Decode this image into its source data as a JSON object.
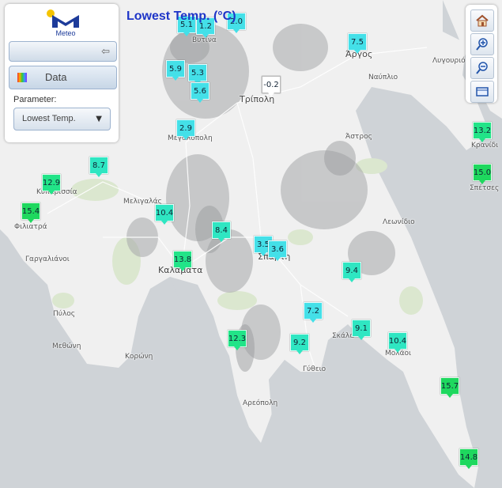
{
  "title": "Lowest Temp. (°C)",
  "panel": {
    "logo_text": "Meteo",
    "data_label": "Data",
    "parameter_label": "Parameter:",
    "parameter_value": "Lowest Temp."
  },
  "tools": [
    "home-icon",
    "zoom-in-icon",
    "zoom-out-icon",
    "extent-icon"
  ],
  "colors": {
    "cold": "#44e0e8",
    "cool": "#2fe6c2",
    "mild": "#22e488",
    "warm": "#1ed85e",
    "freezing": "#ffffff",
    "title": "#1e35c8"
  },
  "places": {
    "argos": "Άργος",
    "nafplio": "Ναύπλιο",
    "lygourio": "Λυγουριό",
    "tripoli": "Τρίπολη",
    "vytina": "Βυτίνα",
    "megalopoli": "Μεγαλόπολη",
    "astros": "Άστρος",
    "kranidi": "Κρανίδι",
    "spetses": "Σπέτσες",
    "kyparissia": "Κυπαρισσία",
    "filiatra": "Φιλιατρά",
    "meligalas": "Μελιγαλάς",
    "gargalianoi": "Γαργαλιάνοι",
    "kalamata": "Καλαμάτα",
    "leonidio": "Λεωνίδιο",
    "sparti": "Σπάρτη",
    "pylos": "Πύλος",
    "methoni": "Μεθώνη",
    "koroni": "Κορώνη",
    "skala": "Σκάλα",
    "molaoi": "Μολάοι",
    "gytheio": "Γύθειο",
    "areopoli": "Αρεόπολη"
  },
  "stations": [
    {
      "value": "5.1",
      "band": "cold"
    },
    {
      "value": "1.2",
      "band": "cold"
    },
    {
      "value": "2.0",
      "band": "cold"
    },
    {
      "value": "7.5",
      "band": "cold"
    },
    {
      "value": "5.9",
      "band": "cold"
    },
    {
      "value": "5.3",
      "band": "cold"
    },
    {
      "value": "-0.2",
      "band": "freezing"
    },
    {
      "value": "5.6",
      "band": "cold"
    },
    {
      "value": "2.9",
      "band": "cold"
    },
    {
      "value": "13.2",
      "band": "mild"
    },
    {
      "value": "8.7",
      "band": "cool"
    },
    {
      "value": "15.0",
      "band": "warm"
    },
    {
      "value": "12.9",
      "band": "mild"
    },
    {
      "value": "15.4",
      "band": "warm"
    },
    {
      "value": "10.4",
      "band": "cool"
    },
    {
      "value": "8.4",
      "band": "cool"
    },
    {
      "value": "3.5",
      "band": "cold"
    },
    {
      "value": "3.6",
      "band": "cold"
    },
    {
      "value": "13.8",
      "band": "mild"
    },
    {
      "value": "9.4",
      "band": "cool"
    },
    {
      "value": "7.2",
      "band": "cold"
    },
    {
      "value": "9.1",
      "band": "cool"
    },
    {
      "value": "12.3",
      "band": "mild"
    },
    {
      "value": "9.2",
      "band": "cool"
    },
    {
      "value": "10.4",
      "band": "cool"
    },
    {
      "value": "15.7",
      "band": "warm"
    },
    {
      "value": "14.8",
      "band": "warm"
    }
  ]
}
